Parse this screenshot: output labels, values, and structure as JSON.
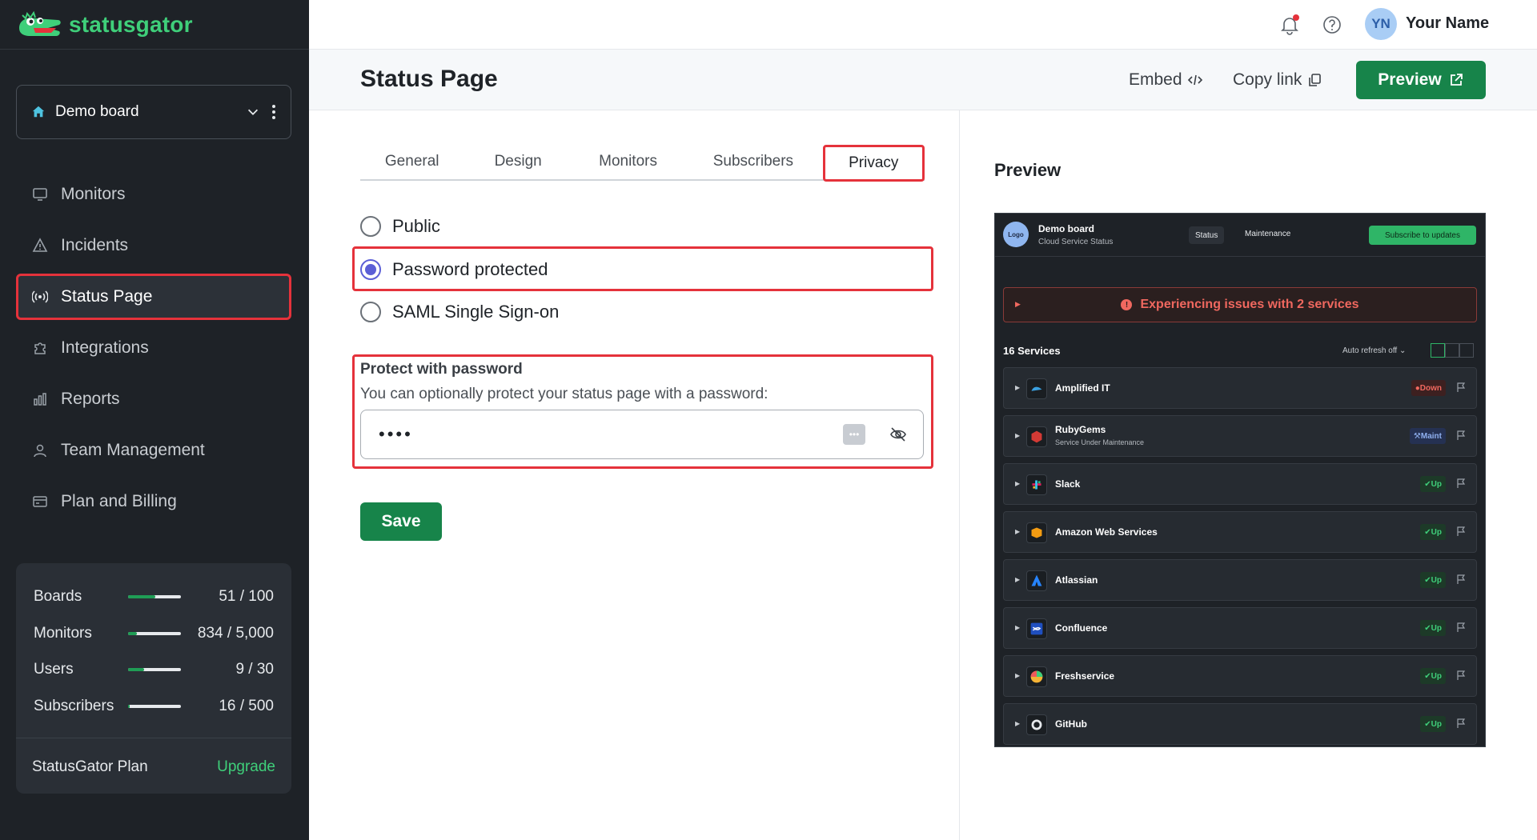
{
  "brand": {
    "name": "statusgator"
  },
  "sidebar": {
    "board": "Demo board",
    "items": [
      {
        "label": "Monitors",
        "icon": "monitor-icon"
      },
      {
        "label": "Incidents",
        "icon": "warning-icon"
      },
      {
        "label": "Status Page",
        "icon": "broadcast-icon",
        "active": true
      },
      {
        "label": "Integrations",
        "icon": "puzzle-icon"
      },
      {
        "label": "Reports",
        "icon": "bar-chart-icon"
      },
      {
        "label": "Team Management",
        "icon": "user-icon"
      },
      {
        "label": "Plan and Billing",
        "icon": "credit-card-icon"
      }
    ],
    "usage": [
      {
        "label": "Boards",
        "value": "51 / 100",
        "fraction": 0.51
      },
      {
        "label": "Monitors",
        "value": "834 / 5,000",
        "fraction": 0.17
      },
      {
        "label": "Users",
        "value": "9 / 30",
        "fraction": 0.3
      },
      {
        "label": "Subscribers",
        "value": "16 / 500",
        "fraction": 0.03
      }
    ],
    "plan": "StatusGator Plan",
    "upgrade": "Upgrade"
  },
  "topbar": {
    "initials": "YN",
    "username": "Your Name"
  },
  "header": {
    "title": "Status Page",
    "embed": "Embed",
    "copy_link": "Copy link",
    "preview": "Preview"
  },
  "tabs": [
    "General",
    "Design",
    "Monitors",
    "Subscribers",
    "Privacy"
  ],
  "privacy": {
    "options": [
      "Public",
      "Password protected",
      "SAML Single Sign-on"
    ],
    "selected": "Password protected",
    "protect_title": "Protect with password",
    "protect_desc": "You can optionally protect your status page with a password:",
    "password_mask": "••••",
    "save": "Save"
  },
  "preview": {
    "title": "Preview",
    "logo": "Logo",
    "board_name": "Demo board",
    "board_sub": "Cloud Service Status",
    "nav_status": "Status",
    "nav_maintenance": "Maintenance",
    "subscribe": "Subscribe to updates",
    "alert": "Experiencing issues with 2 services",
    "services_count": "16 Services",
    "auto_refresh": "Auto refresh off",
    "services": [
      {
        "name": "Amplified IT",
        "sub": "",
        "status": "Down",
        "kind": "down"
      },
      {
        "name": "RubyGems",
        "sub": "Service Under Maintenance",
        "status": "Maint",
        "kind": "maint"
      },
      {
        "name": "Slack",
        "sub": "",
        "status": "Up",
        "kind": "up"
      },
      {
        "name": "Amazon Web Services",
        "sub": "",
        "status": "Up",
        "kind": "up"
      },
      {
        "name": "Atlassian",
        "sub": "",
        "status": "Up",
        "kind": "up"
      },
      {
        "name": "Confluence",
        "sub": "",
        "status": "Up",
        "kind": "up"
      },
      {
        "name": "Freshservice",
        "sub": "",
        "status": "Up",
        "kind": "up"
      },
      {
        "name": "GitHub",
        "sub": "",
        "status": "Up",
        "kind": "up"
      }
    ]
  },
  "colors": {
    "brand_green": "#3fcf7a",
    "button_green": "#17844a",
    "highlight_red": "#e5323b",
    "radio_purple": "#5b5fd6"
  }
}
